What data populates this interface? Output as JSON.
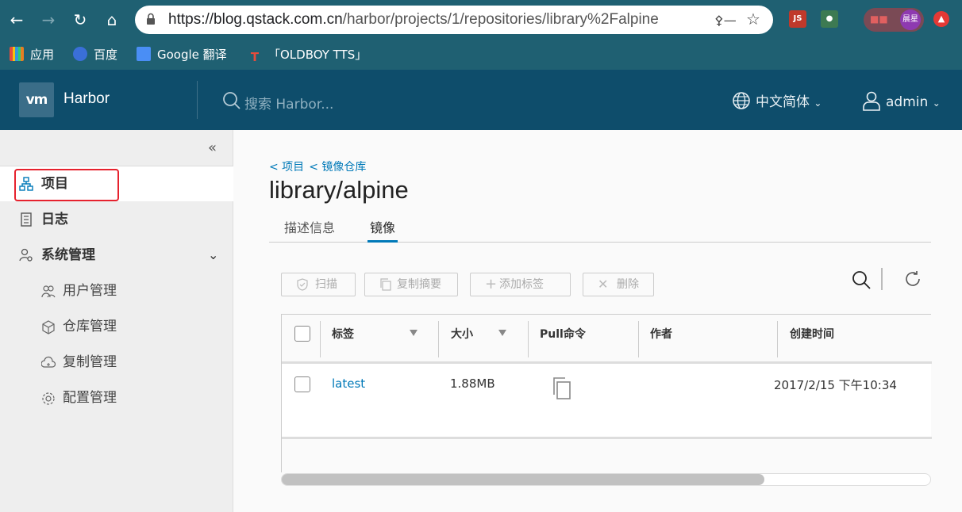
{
  "browser": {
    "url_host": "https://blog.qstack.com.cn",
    "url_path": "/harbor/projects/1/repositories/library%2Falpine",
    "bookmarks": [
      "应用",
      "百度",
      "Google 翻译",
      "「OLDBOY TTS」"
    ],
    "more": "»",
    "profile_label": "晨星"
  },
  "header": {
    "logo_text": "vm",
    "app_name": "Harbor",
    "search_placeholder": "搜索 Harbor...",
    "language": "中文简体",
    "user": "admin"
  },
  "sidebar": {
    "items": [
      {
        "label": "项目",
        "icon": "projects-icon",
        "active": true
      },
      {
        "label": "日志",
        "icon": "logs-icon"
      },
      {
        "label": "系统管理",
        "icon": "admin-icon",
        "expandable": true
      }
    ],
    "sub_items": [
      {
        "label": "用户管理",
        "icon": "users-icon"
      },
      {
        "label": "仓库管理",
        "icon": "registry-icon"
      },
      {
        "label": "复制管理",
        "icon": "replication-icon"
      },
      {
        "label": "配置管理",
        "icon": "config-icon"
      }
    ]
  },
  "main": {
    "breadcrumb": [
      "< 项目",
      "< 镜像仓库"
    ],
    "title": "library/alpine",
    "tabs": [
      {
        "label": "描述信息",
        "active": false
      },
      {
        "label": "镜像",
        "active": true
      }
    ],
    "toolbar": {
      "scan": "扫描",
      "copy_digest": "复制摘要",
      "add_label": "添加标签",
      "delete": "删除"
    },
    "table": {
      "columns": [
        "标签",
        "大小",
        "Pull命令",
        "作者",
        "创建时间"
      ],
      "rows": [
        {
          "tag": "latest",
          "size": "1.88MB",
          "author": "",
          "created": "2017/2/15 下午10:34"
        }
      ]
    }
  },
  "colors": {
    "browser_bar": "#1f6072",
    "harbor_header": "#0e4d6b",
    "link": "#0079b8",
    "highlight_box": "#e6222e"
  }
}
